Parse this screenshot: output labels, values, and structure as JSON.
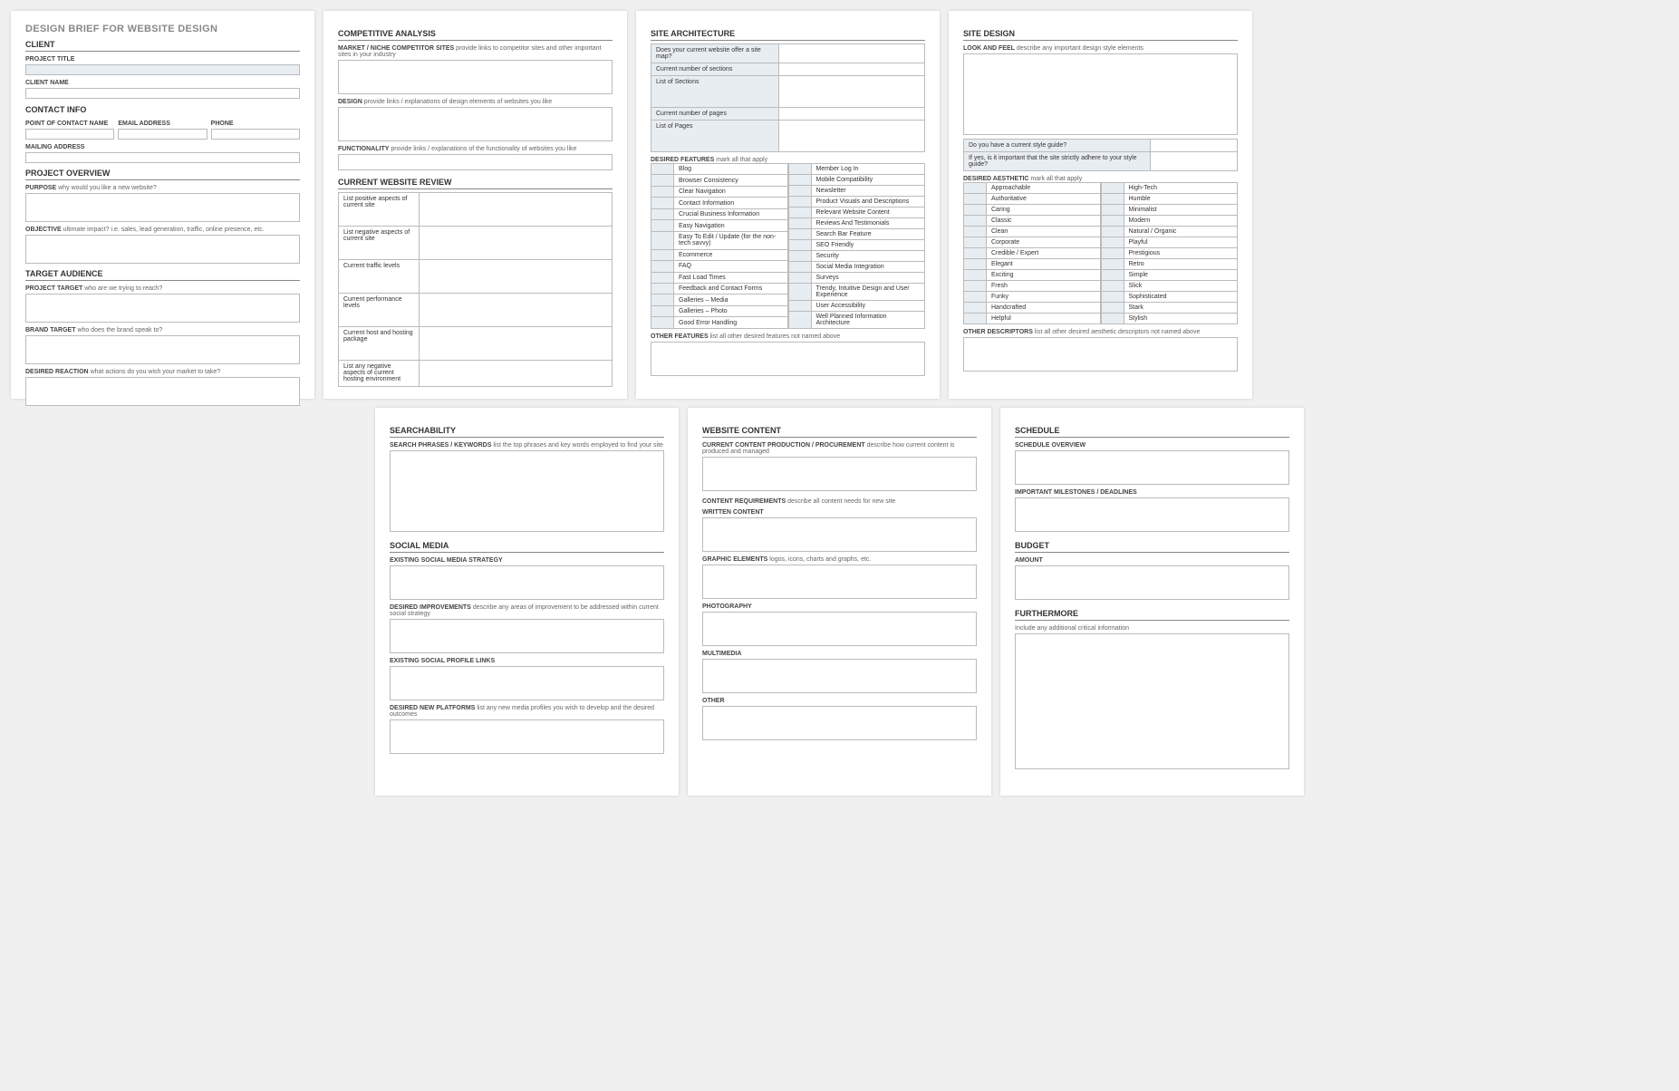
{
  "doc_title": "DESIGN BRIEF FOR WEBSITE DESIGN",
  "p1": {
    "client": "CLIENT",
    "project_title": "PROJECT TITLE",
    "client_name": "CLIENT NAME",
    "contact_info": "CONTACT INFO",
    "poc": "POINT OF CONTACT NAME",
    "email": "EMAIL ADDRESS",
    "phone": "PHONE",
    "mailing": "MAILING ADDRESS",
    "overview": "PROJECT OVERVIEW",
    "purpose": "PURPOSE",
    "purpose_hint": "why would you like a new website?",
    "objective": "OBJECTIVE",
    "objective_hint": "ultimate impact?  i.e. sales, lead generation, traffic, online presence, etc.",
    "target": "TARGET AUDIENCE",
    "project_target": "PROJECT TARGET",
    "project_target_hint": "who are we trying to reach?",
    "brand_target": "BRAND TARGET",
    "brand_target_hint": "who does the brand speak to?",
    "reaction": "DESIRED REACTION",
    "reaction_hint": "what actions do you wish your market to take?"
  },
  "p2": {
    "analysis": "COMPETITIVE ANALYSIS",
    "market": "MARKET / NICHE COMPETITOR SITES",
    "market_hint": "provide links to competitor sites and other important sites in your industry",
    "design": "DESIGN",
    "design_hint": "provide links / explanations of design elements of websites you like",
    "func": "FUNCTIONALITY",
    "func_hint": "provide links / explanations of the functionality of websites you like",
    "review": "CURRENT WEBSITE REVIEW",
    "r1": "List positive aspects of current site",
    "r2": "List negative aspects of current site",
    "r3": "Current traffic levels",
    "r4": "Current performance levels",
    "r5": "Current host and hosting package",
    "r6": "List any negative aspects of current hosting environment"
  },
  "p3": {
    "arch": "SITE ARCHITECTURE",
    "q1": "Does your current website offer a site map?",
    "q2": "Current number of sections",
    "q3": "List of Sections",
    "q4": "Current number of pages",
    "q5": "List of Pages",
    "features": "DESIRED FEATURES",
    "features_hint": "mark all that apply",
    "left": [
      "Blog",
      "Browser Consistency",
      "Clear Navigation",
      "Contact Information",
      "Crucial Business Information",
      "Easy Navigation",
      "Easy To Edit / Update (for the non-tech savvy)",
      "Ecommerce",
      "FAQ",
      "Fast Load Times",
      "Feedback and Contact Forms",
      "Galleries – Media",
      "Galleries – Photo",
      "Good Error Handling"
    ],
    "right": [
      "Member Log In",
      "Mobile Compatibility",
      "Newsletter",
      "Product Visuals and Descriptions",
      "Relevant Website Content",
      "Reviews And Testimonials",
      "Search Bar Feature",
      "SEO Friendly",
      "Security",
      "Social Media Integration",
      "Surveys",
      "Trendy, Intuitive Design and User Experience",
      "User Accessibility",
      "Well Planned Information Architecture"
    ],
    "other": "OTHER FEATURES",
    "other_hint": "list all other desired features not named above"
  },
  "p4": {
    "design": "SITE DESIGN",
    "look": "LOOK AND FEEL",
    "look_hint": "describe any important design style elements",
    "sg1": "Do you have a current style guide?",
    "sg2": "If yes, is it important that the site strictly adhere to your style guide?",
    "aesthetic": "DESIRED AESTHETIC",
    "aesthetic_hint": "mark all that apply",
    "left": [
      "Approachable",
      "Authoritative",
      "Caring",
      "Classic",
      "Clean",
      "Corporate",
      "Credible / Expert",
      "Elegant",
      "Exciting",
      "Fresh",
      "Funky",
      "Handcrafted",
      "Helpful"
    ],
    "right": [
      "High-Tech",
      "Humble",
      "Minimalist",
      "Modern",
      "Natural / Organic",
      "Playful",
      "Prestigious",
      "Retro",
      "Simple",
      "Slick",
      "Sophisticated",
      "Stark",
      "Stylish"
    ],
    "other": "OTHER DESCRIPTORS",
    "other_hint": "list all other desired aesthetic descriptors not named above"
  },
  "p5": {
    "search": "SEARCHABILITY",
    "phrases": "SEARCH PHRASES / KEYWORDS",
    "phrases_hint": "list the top phrases and key words employed to find your site",
    "social": "SOCIAL MEDIA",
    "s1": "EXISTING SOCIAL MEDIA STRATEGY",
    "s2": "DESIRED IMPROVEMENTS",
    "s2_hint": "describe any areas of improvement to be addressed within current social strategy",
    "s3": "EXISTING SOCIAL PROFILE LINKS",
    "s4": "DESIRED NEW PLATFORMS",
    "s4_hint": "list any new media profiles you wish to develop and the desired outcomes"
  },
  "p6": {
    "content": "WEBSITE CONTENT",
    "c1": "CURRENT CONTENT PRODUCTION / PROCUREMENT",
    "c1_hint": "describe how current content is produced and managed",
    "c2": "CONTENT REQUIREMENTS",
    "c2_hint": "describe all content needs for new site",
    "c3": "WRITTEN CONTENT",
    "c4": "GRAPHIC ELEMENTS",
    "c4_hint": "logos, icons, charts and graphs, etc.",
    "c5": "PHOTOGRAPHY",
    "c6": "MULTIMEDIA",
    "c7": "OTHER"
  },
  "p7": {
    "schedule": "SCHEDULE",
    "s1": "SCHEDULE OVERVIEW",
    "s2": "IMPORTANT MILESTONES / DEADLINES",
    "budget": "BUDGET",
    "b1": "AMOUNT",
    "further": "FURTHERMORE",
    "f1": "Include any additional critical information"
  }
}
